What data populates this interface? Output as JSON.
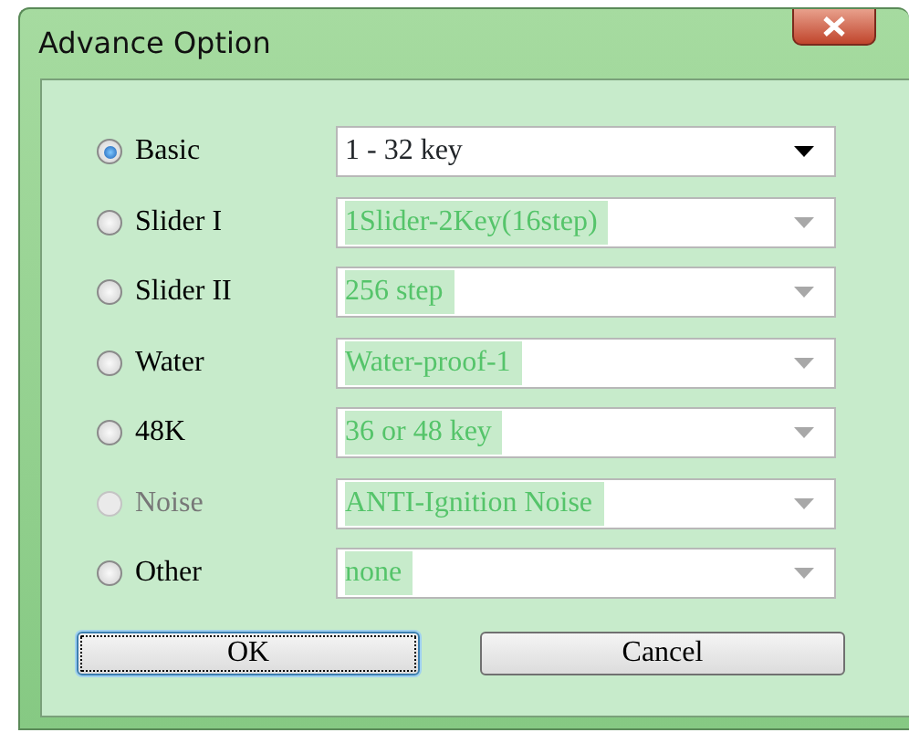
{
  "window": {
    "title": "Advance Option"
  },
  "options": [
    {
      "label": "Basic",
      "selected": true,
      "disabled": false,
      "combo": {
        "value": "1 - 32 key",
        "disabled": false
      }
    },
    {
      "label": "Slider I",
      "selected": false,
      "disabled": false,
      "combo": {
        "value": "1Slider-2Key(16step)",
        "disabled": true
      }
    },
    {
      "label": "Slider II",
      "selected": false,
      "disabled": false,
      "combo": {
        "value": "256 step",
        "disabled": true
      }
    },
    {
      "label": "Water",
      "selected": false,
      "disabled": false,
      "combo": {
        "value": "Water-proof-1",
        "disabled": true
      }
    },
    {
      "label": "48K",
      "selected": false,
      "disabled": false,
      "combo": {
        "value": "36 or 48 key",
        "disabled": true
      }
    },
    {
      "label": "Noise",
      "selected": false,
      "disabled": true,
      "combo": {
        "value": "ANTI-Ignition Noise",
        "disabled": true
      }
    },
    {
      "label": "Other",
      "selected": false,
      "disabled": false,
      "combo": {
        "value": "none",
        "disabled": true
      }
    }
  ],
  "buttons": [
    {
      "label": "OK",
      "focused": true
    },
    {
      "label": "Cancel",
      "focused": false
    }
  ]
}
